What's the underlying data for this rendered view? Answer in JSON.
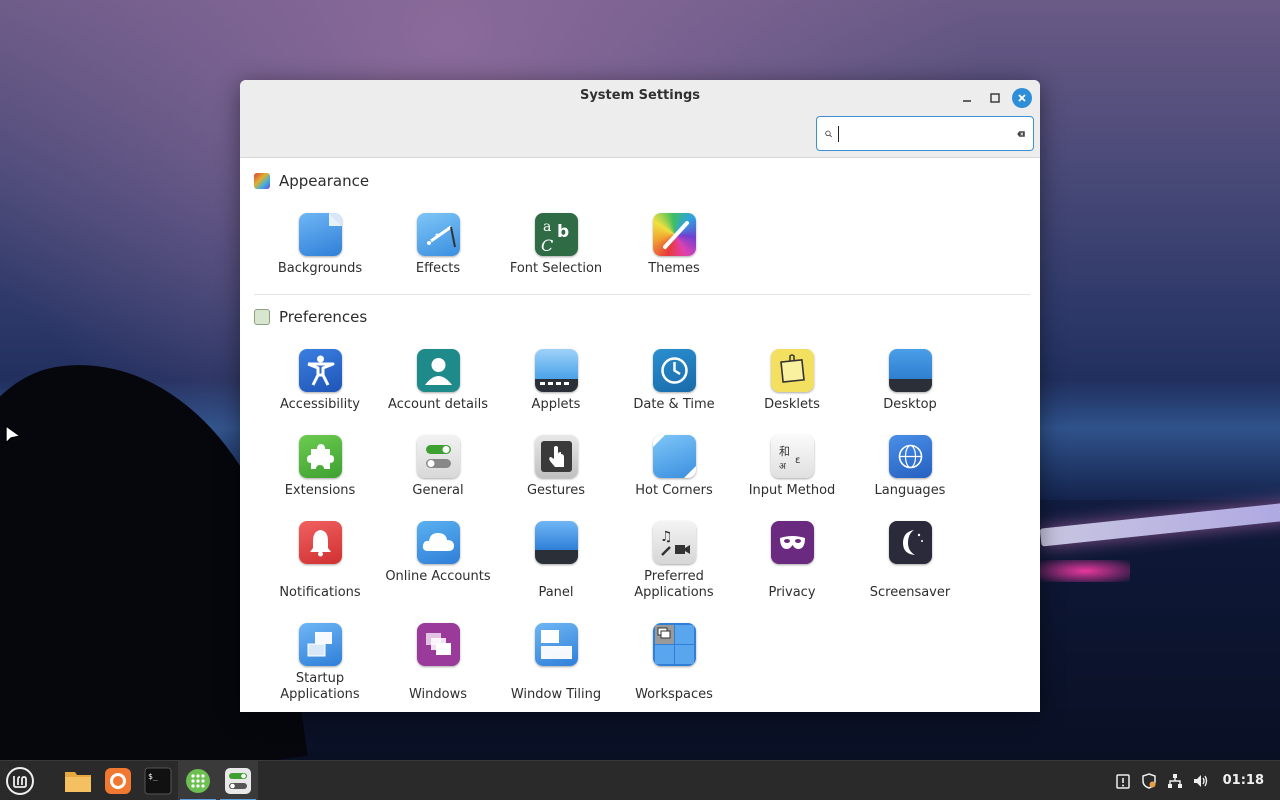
{
  "window": {
    "title": "System Settings",
    "search": {
      "value": "",
      "placeholder": ""
    }
  },
  "sections": [
    {
      "title": "Appearance",
      "items": [
        {
          "label": "Backgrounds",
          "icon": "backgrounds-icon"
        },
        {
          "label": "Effects",
          "icon": "effects-icon"
        },
        {
          "label": "Font Selection",
          "icon": "font-selection-icon"
        },
        {
          "label": "Themes",
          "icon": "themes-icon"
        }
      ]
    },
    {
      "title": "Preferences",
      "items": [
        {
          "label": "Accessibility",
          "icon": "accessibility-icon"
        },
        {
          "label": "Account details",
          "icon": "account-details-icon"
        },
        {
          "label": "Applets",
          "icon": "applets-icon"
        },
        {
          "label": "Date & Time",
          "icon": "clock-icon"
        },
        {
          "label": "Desklets",
          "icon": "desklets-icon"
        },
        {
          "label": "Desktop",
          "icon": "desktop-icon"
        },
        {
          "label": "Extensions",
          "icon": "puzzle-icon"
        },
        {
          "label": "General",
          "icon": "toggles-icon"
        },
        {
          "label": "Gestures",
          "icon": "hand-pointer-icon"
        },
        {
          "label": "Hot Corners",
          "icon": "hot-corners-icon"
        },
        {
          "label": "Input Method",
          "icon": "input-method-icon"
        },
        {
          "label": "Languages",
          "icon": "globe-icon"
        },
        {
          "label": "Notifications",
          "icon": "bell-icon"
        },
        {
          "label": "Online Accounts",
          "icon": "cloud-icon"
        },
        {
          "label": "Panel",
          "icon": "panel-icon"
        },
        {
          "label": "Preferred Applications",
          "icon": "media-icon"
        },
        {
          "label": "Privacy",
          "icon": "mask-icon"
        },
        {
          "label": "Screensaver",
          "icon": "moon-icon"
        },
        {
          "label": "Startup Applications",
          "icon": "startup-icon"
        },
        {
          "label": "Windows",
          "icon": "windows-icon"
        },
        {
          "label": "Window Tiling",
          "icon": "tiling-icon"
        },
        {
          "label": "Workspaces",
          "icon": "workspaces-icon"
        }
      ]
    }
  ],
  "taskbar": {
    "apps": [
      "mint-menu-icon",
      "files-icon",
      "firefox-icon",
      "terminal-icon",
      "software-icon",
      "settings-icon"
    ],
    "clock": "01:18"
  },
  "colors": {
    "accent": "#2e8fd8",
    "taskbar": "#2a2a2a"
  }
}
